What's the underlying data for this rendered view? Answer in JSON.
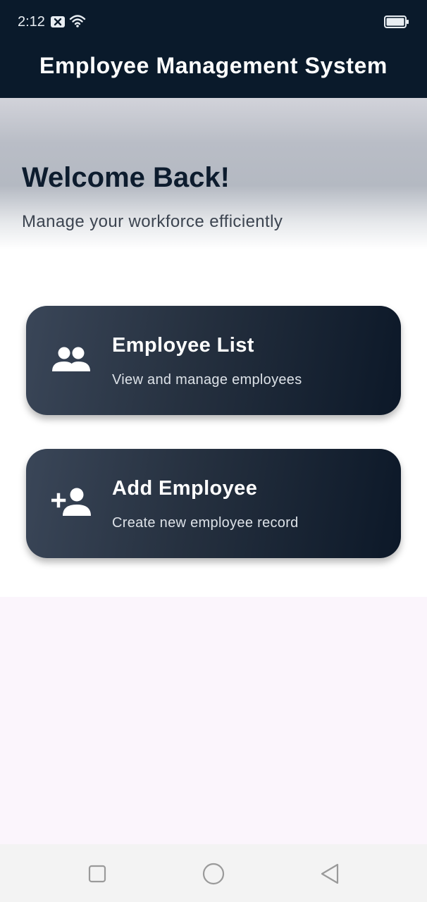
{
  "status_bar": {
    "time": "2:12",
    "icons": [
      "notification-x-icon",
      "wifi-icon",
      "battery-icon"
    ]
  },
  "app_bar": {
    "title": "Employee Management System",
    "background": "#0a1a2b"
  },
  "hero": {
    "heading": "Welcome Back!",
    "subheading": "Manage your workforce efficiently"
  },
  "cards": [
    {
      "title": "Employee List",
      "subtitle": "View and manage employees",
      "icon": "people-icon"
    },
    {
      "title": "Add Employee",
      "subtitle": "Create new employee record",
      "icon": "person-add-icon"
    }
  ],
  "nav_bar": {
    "buttons": [
      "recents-square-icon",
      "home-circle-icon",
      "back-triangle-icon"
    ]
  },
  "colors": {
    "primary_dark": "#0a1a2b",
    "card_gradient_start": "#3a4658",
    "card_gradient_end": "#0c1828",
    "page_background": "#fbf5fc"
  }
}
